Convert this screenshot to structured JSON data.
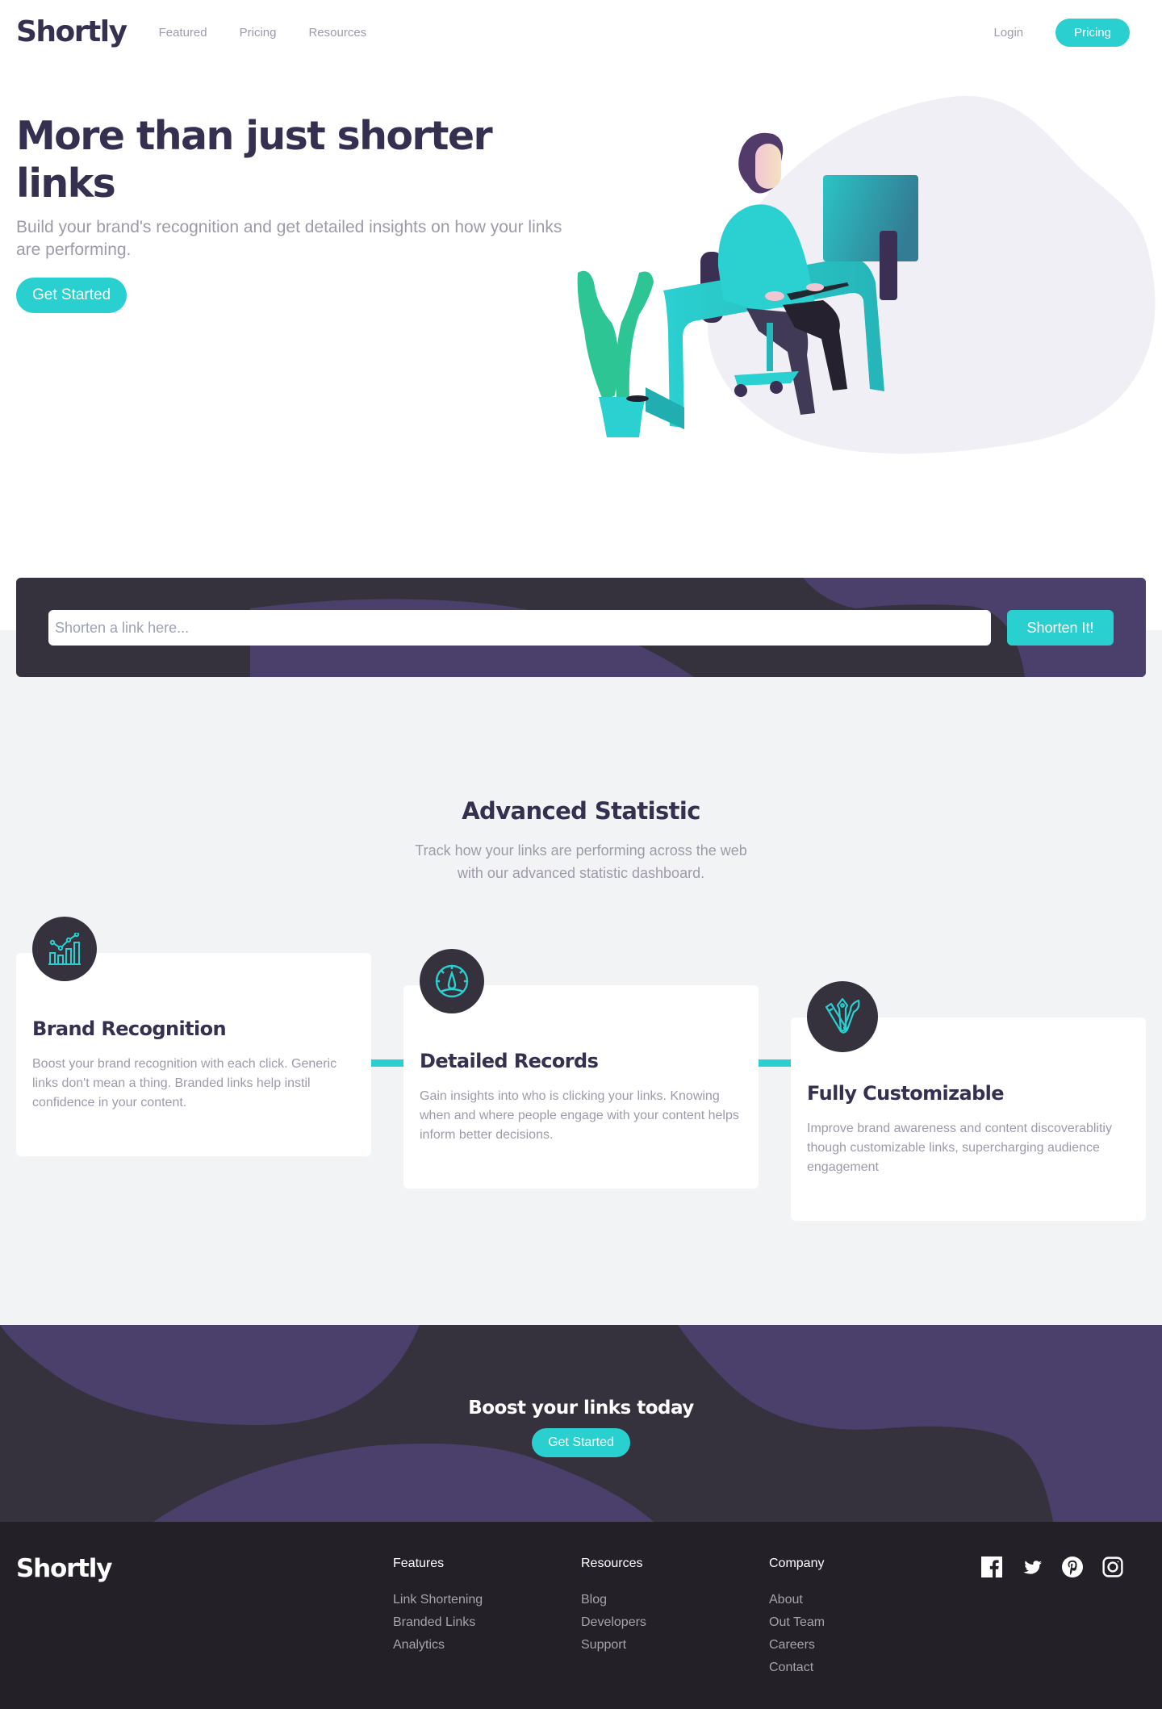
{
  "brand": {
    "name": "Shortly",
    "accent": "#2acfcf",
    "dark_violet": "#35304f",
    "gray_text": "#9e9aa8"
  },
  "header": {
    "nav": [
      {
        "label": "Featured"
      },
      {
        "label": "Pricing"
      },
      {
        "label": "Resources"
      }
    ],
    "login_label": "Login",
    "cta_label": "Pricing"
  },
  "hero": {
    "title": "More than just shorter links",
    "subtitle": "Build your brand's recognition and get detailed insights on how your links are performing.",
    "cta_label": "Get Started",
    "illustration": "person-working-at-desk-illustration"
  },
  "shorten": {
    "input_value": "",
    "placeholder": "Shorten a link here...",
    "button_label": "Shorten It!"
  },
  "stats": {
    "title": "Advanced Statistic",
    "subtitle": "Track how your links are performing across the web with our advanced statistic dashboard.",
    "cards": [
      {
        "icon": "bar-chart-icon",
        "title": "Brand Recognition",
        "text": "Boost your brand recognition with each click. Generic links don't mean a thing. Branded links help instil confidence in your content."
      },
      {
        "icon": "speedometer-icon",
        "title": "Detailed Records",
        "text": "Gain insights into who is clicking your links. Knowing when and where people engage with your content helps inform better decisions."
      },
      {
        "icon": "pen-brush-icon",
        "title": "Fully Customizable",
        "text": "Improve brand awareness and content discoverablitiy though customizable links, supercharging audience engagement"
      }
    ]
  },
  "boost": {
    "title": "Boost your links today",
    "cta_label": "Get Started"
  },
  "footer": {
    "logo": "Shortly",
    "columns": [
      {
        "title": "Features",
        "links": [
          "Link Shortening",
          "Branded Links",
          "Analytics"
        ]
      },
      {
        "title": "Resources",
        "links": [
          "Blog",
          "Developers",
          "Support"
        ]
      },
      {
        "title": "Company",
        "links": [
          "About",
          "Out Team",
          "Careers",
          "Contact"
        ]
      }
    ],
    "socials": [
      "facebook-icon",
      "twitter-icon",
      "pinterest-icon",
      "instagram-icon"
    ]
  }
}
